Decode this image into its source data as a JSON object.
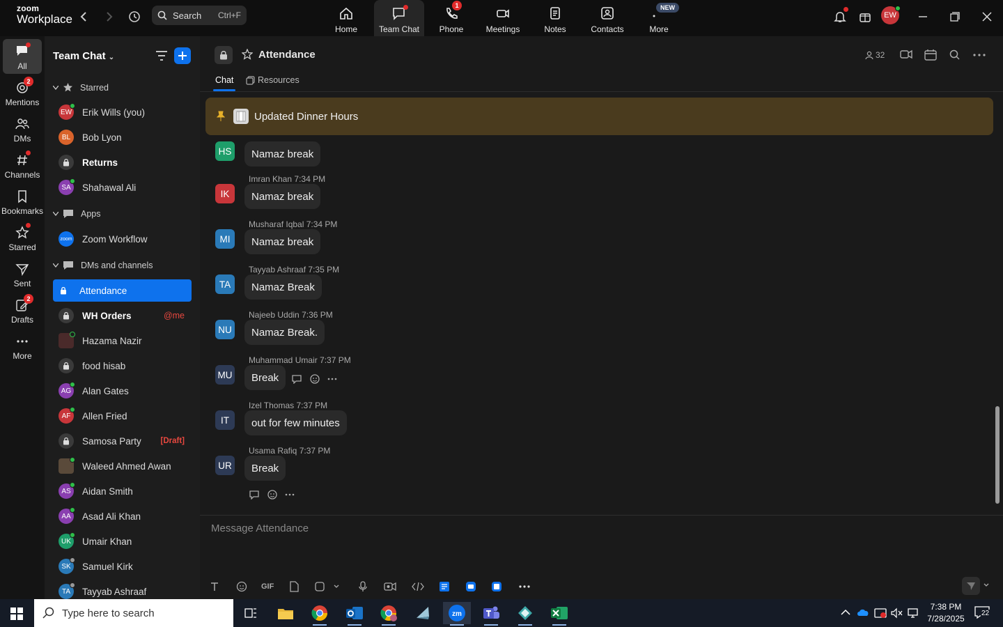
{
  "app": {
    "logo_top": "zoom",
    "logo_bottom": "Workplace"
  },
  "search": {
    "label": "Search",
    "shortcut": "Ctrl+F"
  },
  "topnav": [
    {
      "label": "Home"
    },
    {
      "label": "Team Chat"
    },
    {
      "label": "Phone",
      "badge": "1"
    },
    {
      "label": "Meetings"
    },
    {
      "label": "Notes"
    },
    {
      "label": "Contacts"
    },
    {
      "label": "More",
      "tag": "NEW"
    }
  ],
  "user": {
    "initials": "EW"
  },
  "rail": [
    {
      "label": "All"
    },
    {
      "label": "Mentions",
      "badge": "2"
    },
    {
      "label": "DMs"
    },
    {
      "label": "Channels"
    },
    {
      "label": "Bookmarks"
    },
    {
      "label": "Starred"
    },
    {
      "label": "Sent"
    },
    {
      "label": "Drafts",
      "badge": "2"
    },
    {
      "label": "More"
    }
  ],
  "sidebar": {
    "title": "Team Chat",
    "sections": {
      "starred": "Starred",
      "apps": "Apps",
      "dms": "DMs and channels"
    },
    "starred": [
      {
        "name": "Erik Wills (you)",
        "initials": "EW",
        "color": "#c8363a"
      },
      {
        "name": "Bob Lyon",
        "initials": "BL",
        "color": "#d9632b"
      },
      {
        "name": "Returns"
      },
      {
        "name": "Shahawal Ali",
        "initials": "SA",
        "color": "#8a3fb0"
      }
    ],
    "apps": [
      {
        "name": "Zoom Workflow",
        "initials": "zoom"
      }
    ],
    "dms": [
      {
        "name": "Attendance"
      },
      {
        "name": "WH Orders",
        "tag": "@me"
      },
      {
        "name": "Hazama Nazir"
      },
      {
        "name": "food hisab"
      },
      {
        "name": "Alan Gates",
        "initials": "AG",
        "color": "#8a3fb0"
      },
      {
        "name": "Allen Fried",
        "initials": "AF",
        "color": "#c8363a"
      },
      {
        "name": "Samosa Party",
        "tag": "[Draft]"
      },
      {
        "name": "Waleed Ahmed Awan"
      },
      {
        "name": "Aidan Smith",
        "initials": "AS",
        "color": "#8a3fb0"
      },
      {
        "name": "Asad Ali Khan",
        "initials": "AA",
        "color": "#8a3fb0"
      },
      {
        "name": "Umair Khan",
        "initials": "UK",
        "color": "#1e9e6a"
      },
      {
        "name": "Samuel Kirk",
        "initials": "SK",
        "color": "#2a7ab8"
      },
      {
        "name": "Tayyab Ashraaf",
        "initials": "TA",
        "color": "#2a7ab8"
      }
    ]
  },
  "channel": {
    "title": "Attendance",
    "members": "32",
    "tabs": [
      "Chat",
      "Resources"
    ],
    "pinned": "Updated Dinner Hours",
    "compose_placeholder": "Message Attendance"
  },
  "messages": [
    {
      "initials": "HS",
      "color": "#1e9e6a",
      "sender": "",
      "time": "",
      "text": "Namaz break"
    },
    {
      "initials": "IK",
      "color": "#c8363a",
      "sender": "Imran Khan",
      "time": "7:34 PM",
      "text": "Namaz break"
    },
    {
      "initials": "MI",
      "color": "#2a7ab8",
      "sender": "Musharaf Iqbal",
      "time": "7:34 PM",
      "text": "Namaz break"
    },
    {
      "initials": "TA",
      "color": "#2a7ab8",
      "sender": "Tayyab Ashraaf",
      "time": "7:35 PM",
      "text": "Namaz Break"
    },
    {
      "initials": "NU",
      "color": "#2a7ab8",
      "sender": "Najeeb Uddin",
      "time": "7:36 PM",
      "text": "Namaz Break."
    },
    {
      "initials": "MU",
      "color": "#2d3a55",
      "sender": "Muhammad Umair",
      "time": "7:37 PM",
      "text": "Break"
    },
    {
      "initials": "IT",
      "color": "#2d3a55",
      "sender": "Izel Thomas",
      "time": "7:37 PM",
      "text": "out for few minutes"
    },
    {
      "initials": "UR",
      "color": "#2d3a55",
      "sender": "Usama Rafiq",
      "time": "7:37 PM",
      "text": "Break"
    }
  ],
  "compose_tools": {
    "gif": "GIF"
  },
  "taskbar": {
    "search_placeholder": "Type here to search",
    "time": "7:38 PM",
    "date": "7/28/2025",
    "notifications": "22"
  }
}
